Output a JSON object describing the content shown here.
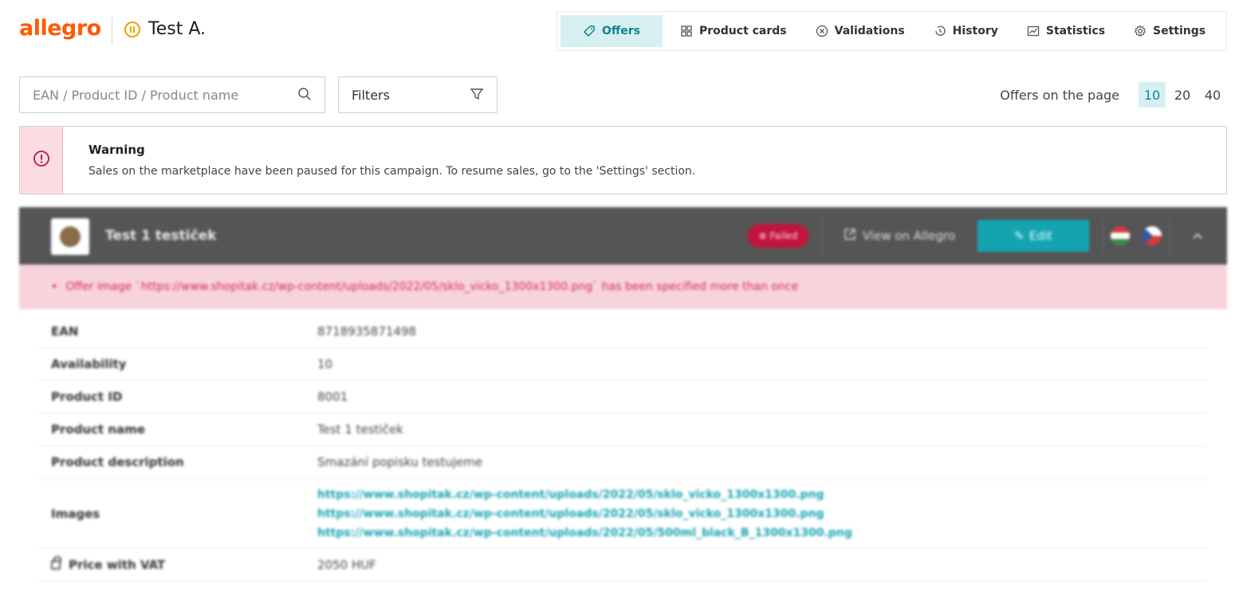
{
  "header": {
    "logo": "allegro",
    "account_name": "Test A."
  },
  "nav": {
    "items": [
      {
        "label": "Offers",
        "icon": "tag-icon",
        "active": true
      },
      {
        "label": "Product cards",
        "icon": "grid-icon"
      },
      {
        "label": "Validations",
        "icon": "x-circle-icon"
      },
      {
        "label": "History",
        "icon": "history-icon"
      },
      {
        "label": "Statistics",
        "icon": "chart-icon"
      },
      {
        "label": "Settings",
        "icon": "gear-icon"
      }
    ]
  },
  "search": {
    "placeholder": "EAN / Product ID / Product name"
  },
  "filters": {
    "label": "Filters"
  },
  "per_page": {
    "label": "Offers on the page",
    "options": [
      "10",
      "20",
      "40"
    ],
    "selected": "10"
  },
  "warning": {
    "title": "Warning",
    "text": "Sales on the marketplace have been paused for this campaign. To resume sales, go to the 'Settings' section."
  },
  "offer": {
    "title": "Test 1 testiček",
    "status": "Failed",
    "view_label": "View on Allegro",
    "edit_label": "Edit",
    "error": "Offer image `https://www.shopitak.cz/wp-content/uploads/2022/05/sklo_vicko_1300x1300.png` has been specified more than once",
    "rows": {
      "ean": {
        "label": "EAN",
        "value": "8718935871498"
      },
      "availability": {
        "label": "Availability",
        "value": "10"
      },
      "product_id": {
        "label": "Product ID",
        "value": "8001"
      },
      "product_name": {
        "label": "Product name",
        "value": "Test 1 testiček"
      },
      "description": {
        "label": "Product description",
        "value": "Smazání popisku testujeme"
      },
      "images": {
        "label": "Images",
        "links": [
          "https://www.shopitak.cz/wp-content/uploads/2022/05/sklo_vicko_1300x1300.png",
          "https://www.shopitak.cz/wp-content/uploads/2022/05/sklo_vicko_1300x1300.png",
          "https://www.shopitak.cz/wp-content/uploads/2022/05/500ml_black_B_1300x1300.png"
        ]
      },
      "price": {
        "label": "Price with VAT",
        "value": "2050 HUF"
      }
    }
  },
  "colors": {
    "brand": "#ff5a00",
    "accent": "#11848d",
    "error": "#d62950",
    "header_bg": "#555555"
  }
}
